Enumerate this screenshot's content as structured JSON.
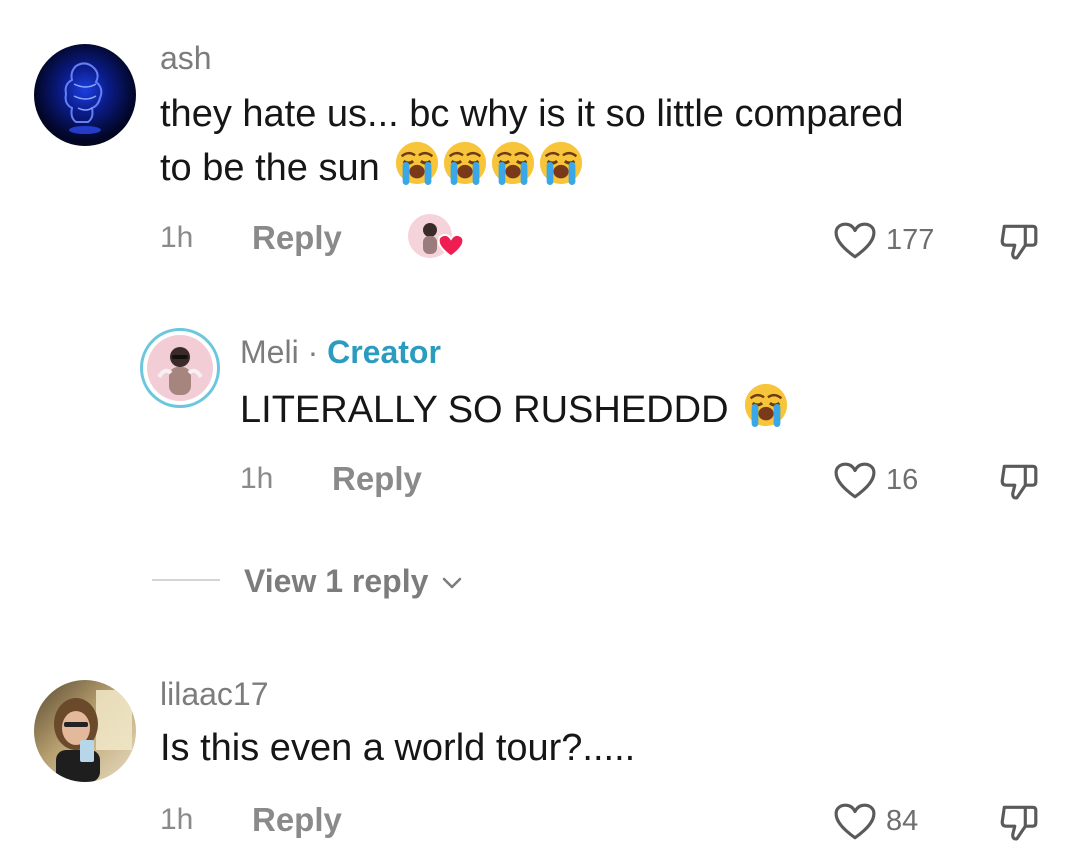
{
  "comments": [
    {
      "username": "ash",
      "text_line1": "they hate us... bc why is it so little compared",
      "text_line2": "to be the sun",
      "emoji_count": 4,
      "time": "1h",
      "reply_label": "Reply",
      "likes": "177",
      "creator_liked": true
    },
    {
      "username": "Meli",
      "separator": " · ",
      "badge": "Creator",
      "text": "LITERALLY SO RUSHEDDD",
      "emoji_count": 1,
      "time": "1h",
      "reply_label": "Reply",
      "likes": "16"
    },
    {
      "username": "lilaac17",
      "text": "Is this even a world tour?.....",
      "time": "1h",
      "reply_label": "Reply",
      "likes": "84"
    }
  ],
  "view_replies": {
    "label": "View 1 reply",
    "icon": "chevron-down-icon"
  },
  "colors": {
    "creator": "#2b9cc0",
    "heart_badge": "#ee1d52",
    "muted_text": "#8a8a8a"
  }
}
